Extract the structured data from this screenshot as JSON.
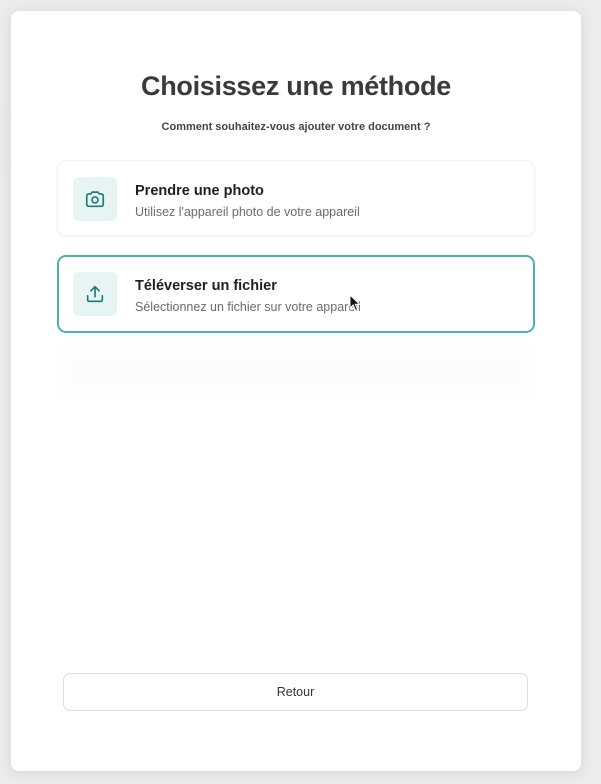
{
  "modal": {
    "title": "Choisissez une méthode",
    "subtitle": "Comment souhaitez-vous ajouter votre document ?"
  },
  "options": [
    {
      "title": "Prendre une photo",
      "description": "Utilisez l'appareil photo de votre appareil",
      "icon": "camera-icon",
      "selected": false
    },
    {
      "title": "Téléverser un fichier",
      "description": "Sélectionnez un fichier sur votre appareil",
      "icon": "upload-icon",
      "selected": true
    }
  ],
  "footer": {
    "back_label": "Retour"
  },
  "colors": {
    "accent": "#4bb3aa",
    "icon_bg": "#e6f5f3",
    "icon_stroke": "#1f7a72",
    "title_text": "#3a3a3a"
  }
}
